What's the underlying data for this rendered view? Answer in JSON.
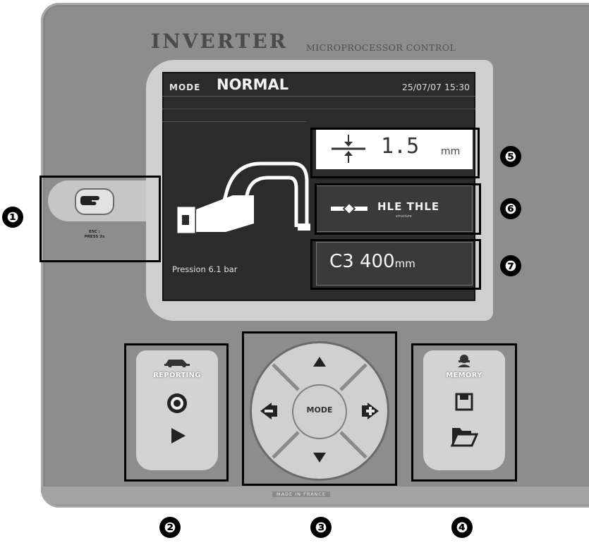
{
  "header": {
    "brand": "INVERTER",
    "subtitle": "MICROPROCESSOR CONTROL"
  },
  "screen": {
    "mode_label": "MODE",
    "mode_value": "NORMAL",
    "datetime": "25/07/07 15:30",
    "pressure": "Pression 6.1 bar",
    "thickness": {
      "value": "1.5",
      "unit": "mm",
      "icon": "sheet-thickness-icon"
    },
    "structure": {
      "value": "HLE  THLE",
      "sub": "structure",
      "icon": "structure-icon"
    },
    "arm": {
      "value": "C3 400",
      "unit": "mm"
    }
  },
  "esc": {
    "line1": "ESC :",
    "line2": "PRESS 2s",
    "icon": "hand-pointer-icon"
  },
  "reporting": {
    "label": "REPORTING",
    "icons": [
      "car-icon",
      "record-icon",
      "play-icon"
    ]
  },
  "dpad": {
    "center_label": "MODE",
    "icons": [
      "arrow-up-icon",
      "arrow-down-icon",
      "minus-left-icon",
      "plus-right-icon"
    ]
  },
  "memory": {
    "label": "MEMORY",
    "icons": [
      "user-icon",
      "save-icon",
      "folder-open-icon"
    ]
  },
  "footer": {
    "made_in": "MADE IN FRANCE"
  },
  "callouts": {
    "c1": "❶",
    "c2": "❷",
    "c3": "❸",
    "c4": "❹",
    "c5": "❺",
    "c6": "❻",
    "c7": "❼"
  }
}
